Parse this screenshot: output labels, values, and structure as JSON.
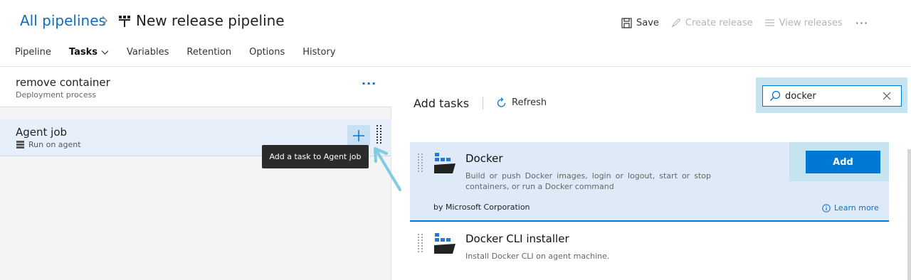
{
  "breadcrumb": {
    "root": "All pipelines",
    "title": "New release pipeline"
  },
  "header": {
    "save": "Save",
    "create_release": "Create release",
    "view_releases": "View releases",
    "more": "···"
  },
  "tabs": [
    {
      "label": "Pipeline",
      "active": false
    },
    {
      "label": "Tasks",
      "active": true
    },
    {
      "label": "Variables",
      "active": false
    },
    {
      "label": "Retention",
      "active": false
    },
    {
      "label": "Options",
      "active": false
    },
    {
      "label": "History",
      "active": false
    }
  ],
  "process": {
    "title": "remove container",
    "subtitle": "Deployment process",
    "more": "···"
  },
  "agent_job": {
    "title": "Agent job",
    "subtitle": "Run on agent",
    "add_glyph": "+",
    "tooltip": "Add a task to Agent job"
  },
  "task_panel": {
    "title": "Add tasks",
    "refresh": "Refresh",
    "search": {
      "value": "docker"
    },
    "tasks": [
      {
        "name": "Docker",
        "description": "Build or push Docker images, login or logout, start or stop containers, or run a Docker command",
        "by": "by Microsoft Corporation",
        "learn_more": "Learn more",
        "add": "Add"
      },
      {
        "name": "Docker CLI installer",
        "description": "Install Docker CLI on agent machine."
      }
    ]
  },
  "colors": {
    "accent": "#0078d4",
    "link": "#106ebe",
    "highlight": "#c5e4ef",
    "selected_row": "#dfeaf8",
    "tooltip": "#2b2b2b"
  }
}
